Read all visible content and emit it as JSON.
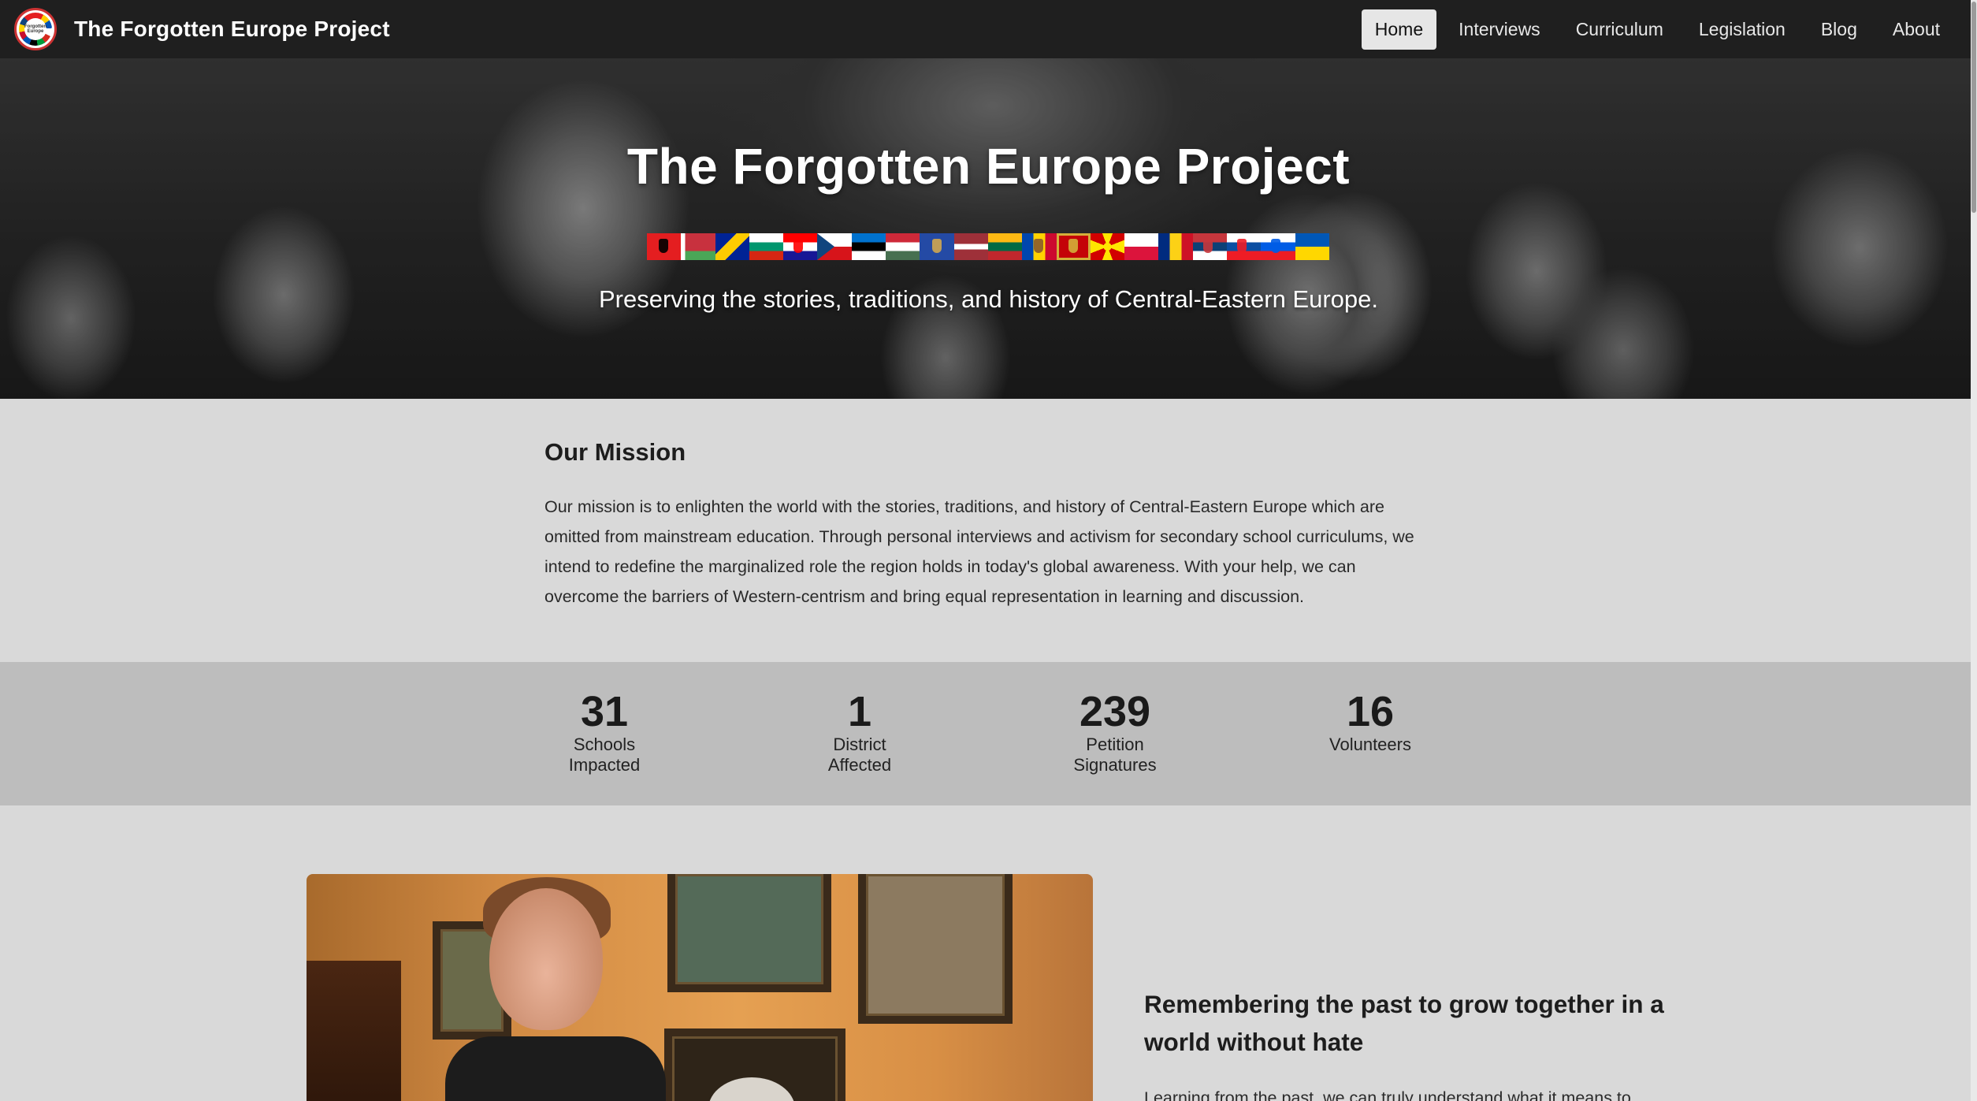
{
  "navbar": {
    "brand_title": "The Forgotten Europe Project",
    "logo_text": "Forgotten Europe",
    "links": [
      {
        "label": "Home",
        "active": true
      },
      {
        "label": "Interviews",
        "active": false
      },
      {
        "label": "Curriculum",
        "active": false
      },
      {
        "label": "Legislation",
        "active": false
      },
      {
        "label": "Blog",
        "active": false
      },
      {
        "label": "About",
        "active": false
      }
    ]
  },
  "hero": {
    "title": "The Forgotten Europe Project",
    "subtitle": "Preserving the stories, traditions, and history of Central-Eastern Europe.",
    "flags": [
      {
        "country": "Albania",
        "colors": [
          "#e41e20"
        ],
        "layout": "solid",
        "emblem": "#000000"
      },
      {
        "country": "Belarus",
        "colors": [
          "#c8313e",
          "#4aa657"
        ],
        "layout": "belarus"
      },
      {
        "country": "Bosnia and Herzegovina",
        "colors": [
          "#002395",
          "#fecb00"
        ],
        "layout": "bosnia"
      },
      {
        "country": "Bulgaria",
        "colors": [
          "#ffffff",
          "#00966e",
          "#d62612"
        ],
        "layout": "horizontal"
      },
      {
        "country": "Croatia",
        "colors": [
          "#ff0000",
          "#ffffff",
          "#171796"
        ],
        "layout": "horizontal",
        "emblem": "#ff0000"
      },
      {
        "country": "Czechia",
        "colors": [
          "#ffffff",
          "#d7141a",
          "#11457e"
        ],
        "layout": "czech"
      },
      {
        "country": "Estonia",
        "colors": [
          "#0072ce",
          "#000000",
          "#ffffff"
        ],
        "layout": "horizontal"
      },
      {
        "country": "Hungary",
        "colors": [
          "#ce2939",
          "#ffffff",
          "#477050"
        ],
        "layout": "horizontal"
      },
      {
        "country": "Kosovo",
        "colors": [
          "#244aa5"
        ],
        "layout": "solid",
        "emblem": "#d0a650"
      },
      {
        "country": "Latvia",
        "colors": [
          "#9e3039",
          "#ffffff",
          "#9e3039"
        ],
        "layout": "latvia"
      },
      {
        "country": "Lithuania",
        "colors": [
          "#fdb913",
          "#006a44",
          "#c1272d"
        ],
        "layout": "horizontal"
      },
      {
        "country": "Moldova",
        "colors": [
          "#0046ae",
          "#ffd200",
          "#cc092f"
        ],
        "layout": "vertical",
        "emblem": "#8a5a2b"
      },
      {
        "country": "Montenegro",
        "colors": [
          "#c40308"
        ],
        "layout": "bordered",
        "emblem": "#d4af3a"
      },
      {
        "country": "North Macedonia",
        "colors": [
          "#d20000",
          "#ffe600"
        ],
        "layout": "macedonia"
      },
      {
        "country": "Poland",
        "colors": [
          "#ffffff",
          "#dc143c"
        ],
        "layout": "horizontal"
      },
      {
        "country": "Romania",
        "colors": [
          "#002b7f",
          "#fcd116",
          "#ce1126"
        ],
        "layout": "vertical"
      },
      {
        "country": "Serbia",
        "colors": [
          "#c6363c",
          "#0c4076",
          "#ffffff"
        ],
        "layout": "horizontal",
        "emblem": "#c6363c"
      },
      {
        "country": "Slovakia",
        "colors": [
          "#ffffff",
          "#0b4ea2",
          "#ee1c25"
        ],
        "layout": "horizontal",
        "emblem": "#ee1c25"
      },
      {
        "country": "Slovenia",
        "colors": [
          "#ffffff",
          "#005ce5",
          "#ed1c24"
        ],
        "layout": "horizontal",
        "emblem": "#005ce5"
      },
      {
        "country": "Ukraine",
        "colors": [
          "#0057b7",
          "#ffd700"
        ],
        "layout": "horizontal"
      }
    ]
  },
  "mission": {
    "heading": "Our Mission",
    "lines": [
      "Our mission is to enlighten the world with the stories, traditions, and history of Central-Eastern Europe which are",
      "omitted from mainstream education. Through personal interviews and activism for secondary school curriculums, we",
      "intend to redefine the marginalized role the region holds in today's global awareness. With your help, we can",
      "overcome the barriers of Western-centrism and bring equal representation in learning and discussion."
    ]
  },
  "stats": [
    {
      "number": "31",
      "label_line1": "Schools",
      "label_line2": "Impacted"
    },
    {
      "number": "1",
      "label_line1": "District",
      "label_line2": "Affected"
    },
    {
      "number": "239",
      "label_line1": "Petition",
      "label_line2": "Signatures"
    },
    {
      "number": "16",
      "label_line1": "Volunteers",
      "label_line2": ""
    }
  ],
  "feature": {
    "heading_line1": "Remembering the past to grow together in a",
    "heading_line2": "world without hate",
    "text_partial": "Learning from the past, we can truly understand what it means to"
  },
  "colors": {
    "navbar_bg": "#1f1f1f",
    "page_bg": "#d9d9d9",
    "stats_bg": "#bdbdbd",
    "active_nav_bg": "#e6e6e6"
  }
}
